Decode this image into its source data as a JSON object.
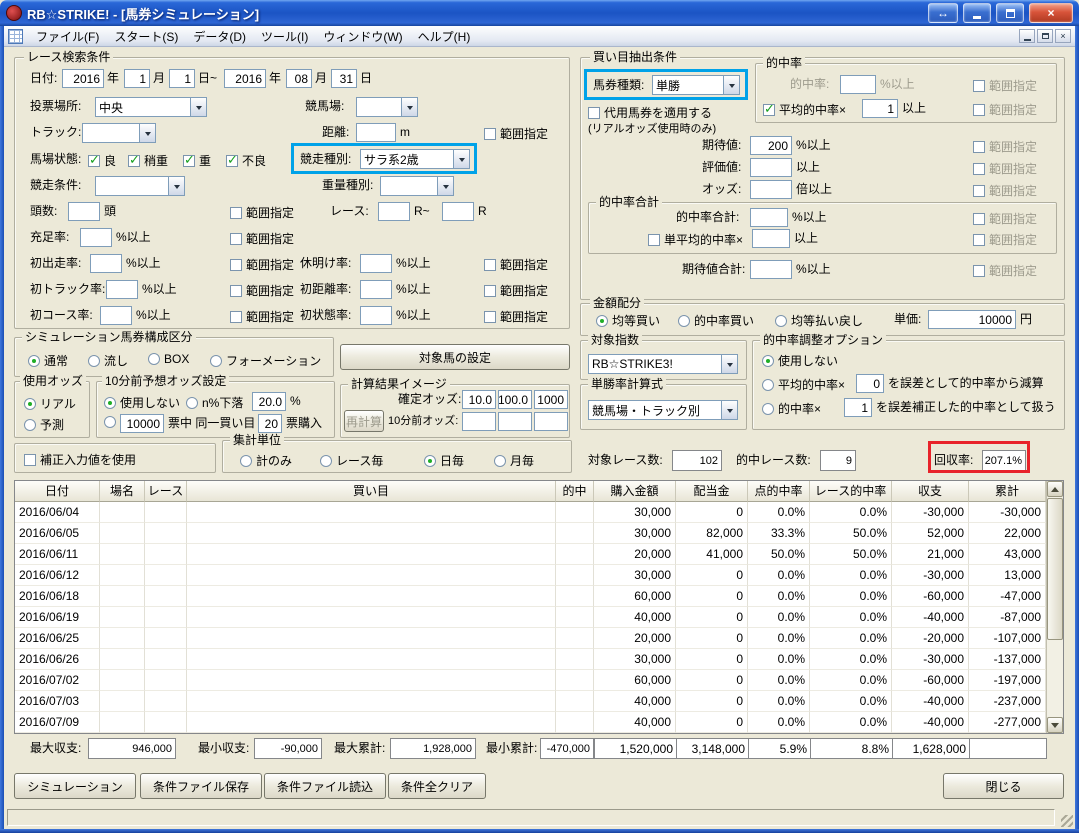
{
  "window": {
    "title": "RB☆STRIKE! - [馬券シミュレーション]"
  },
  "menu": {
    "items": [
      "ファイル(F)",
      "スタート(S)",
      "データ(D)",
      "ツール(I)",
      "ウィンドウ(W)",
      "ヘルプ(H)"
    ]
  },
  "icons": {
    "swap": "↔",
    "close": "×",
    "mdi_close": "×"
  },
  "common": {
    "range": "範囲指定",
    "pct_min": "%以上",
    "min": "以上"
  },
  "race_search": {
    "title": "レース検索条件",
    "date": {
      "label": "日付:",
      "from_year": "2016",
      "y1": "年",
      "from_month": "1",
      "m1": "月",
      "from_day": "1",
      "d1": "日~",
      "to_year": "2016",
      "y2": "年",
      "to_month": "08",
      "m2": "月",
      "to_day": "31",
      "d2": "日"
    },
    "place": {
      "label": "投票場所:",
      "value": "中央"
    },
    "course": {
      "label": "競馬場:",
      "value": ""
    },
    "track": {
      "label": "トラック:",
      "value": ""
    },
    "distance": {
      "label": "距離:",
      "value": "",
      "unit": "m"
    },
    "baba_label": "馬場状態:",
    "cond_good": {
      "label": "良",
      "checked": true
    },
    "cond_yayaomo": {
      "label": "稍重",
      "checked": true
    },
    "cond_omo": {
      "label": "重",
      "checked": true
    },
    "cond_bad": {
      "label": "不良",
      "checked": true
    },
    "race_type": {
      "label": "競走種別:",
      "value": "サラ系2歳"
    },
    "race_cond": {
      "label": "競走条件:",
      "value": ""
    },
    "weight_type": {
      "label": "重量種別:",
      "value": ""
    },
    "heads": {
      "label": "頭数:",
      "value": "",
      "unit": "頭"
    },
    "race_no": {
      "label": "レース:",
      "from": "",
      "mid": "R~",
      "to": "",
      "unit": "R"
    },
    "fill_rate": {
      "label": "充足率:",
      "value": ""
    },
    "first_run": {
      "label": "初出走率:",
      "value": ""
    },
    "rest_rate": {
      "label": "休明け率:",
      "value": ""
    },
    "first_track": {
      "label": "初トラック率:",
      "value": ""
    },
    "first_dist": {
      "label": "初距離率:",
      "value": ""
    },
    "first_course": {
      "label": "初コース率:",
      "value": ""
    },
    "first_cond": {
      "label": "初状態率:",
      "value": ""
    }
  },
  "extraction": {
    "title": "買い目抽出条件",
    "ticket": {
      "label": "馬券種類:",
      "value": "単勝"
    },
    "hit_group": {
      "title": "的中率",
      "hit_rate": {
        "label": "的中率:",
        "value": ""
      },
      "avg_hit": {
        "label": "平均的中率×",
        "value": "1",
        "checked": true
      }
    },
    "substitute": {
      "label": "代用馬券を適用する",
      "checked": false,
      "note": "(リアルオッズ使用時のみ)"
    },
    "expectation": {
      "label": "期待値:",
      "value": "200"
    },
    "evaluation": {
      "label": "評価値:",
      "value": ""
    },
    "odds": {
      "label": "オッズ:",
      "value": "",
      "unit": "倍以上"
    },
    "total_group": {
      "title": "的中率合計",
      "hit_total": {
        "label": "的中率合計:",
        "value": ""
      },
      "single_avg": {
        "label": "単平均的中率×",
        "value": "",
        "checked": false
      }
    },
    "exp_total": {
      "label": "期待値合計:",
      "value": ""
    }
  },
  "amount": {
    "title": "金額配分",
    "equal": {
      "label": "均等買い",
      "checked": true
    },
    "hit_buy": {
      "label": "的中率買い",
      "checked": false
    },
    "equal_refund": {
      "label": "均等払い戻し",
      "checked": false
    },
    "unit_price": {
      "label": "単価:",
      "value": "10000",
      "unit": "円"
    }
  },
  "composition": {
    "title": "シミュレーション馬券構成区分",
    "normal": {
      "label": "通常",
      "checked": true
    },
    "nagashi": {
      "label": "流し",
      "checked": false
    },
    "box": {
      "label": "BOX",
      "checked": false
    },
    "formation": {
      "label": "フォーメーション",
      "checked": false
    }
  },
  "target_horse_button": "対象馬の設定",
  "odds_use": {
    "title": "使用オッズ",
    "real": {
      "label": "リアル",
      "checked": true
    },
    "predict": {
      "label": "予測",
      "checked": false
    }
  },
  "pre_odds": {
    "title": "10分前予想オッズ設定",
    "not_use": {
      "label": "使用しない",
      "checked": true
    },
    "drop": {
      "label": "n%下落",
      "value": "20.0",
      "unit": "%",
      "checked": false
    },
    "votes": {
      "checked": false,
      "value": "10000",
      "mid": "票中 同一買い目",
      "value2": "20",
      "unit": "票購入"
    }
  },
  "calc_image": {
    "title": "計算結果イメージ",
    "fixed_label": "確定オッズ:",
    "fixed": [
      "10.0",
      "100.0",
      "1000"
    ],
    "recalc": "再計算",
    "pre_label": "10分前オッズ:",
    "pre": [
      "",
      "",
      ""
    ]
  },
  "target_index": {
    "title": "対象指数",
    "value": "RB☆STRIKE3!"
  },
  "win_formula": {
    "title": "単勝率計算式",
    "value": "競馬場・トラック別"
  },
  "hit_adjust": {
    "title": "的中率調整オプション",
    "not_use": {
      "label": "使用しない",
      "checked": true
    },
    "avg": {
      "label": "平均的中率×",
      "value": "0",
      "suffix": "を誤差として的中率から減算",
      "checked": false
    },
    "hit": {
      "label": "的中率×",
      "value": "1",
      "suffix": "を誤差補正した的中率として扱う",
      "checked": false
    }
  },
  "correction": {
    "label": "補正入力値を使用",
    "checked": false
  },
  "agg": {
    "title": "集計単位",
    "total_only": {
      "label": "計のみ",
      "checked": false
    },
    "per_race": {
      "label": "レース毎",
      "checked": false
    },
    "per_day": {
      "label": "日毎",
      "checked": true
    },
    "per_month": {
      "label": "月毎",
      "checked": false
    }
  },
  "counts": {
    "target_label": "対象レース数:",
    "target": "102",
    "hit_label": "的中レース数:",
    "hit": "9",
    "recovery_label": "回収率:",
    "recovery": "207.1%"
  },
  "table": {
    "headers": [
      "日付",
      "場名",
      "レース",
      "買い目",
      "的中",
      "購入金額",
      "配当金",
      "点的中率",
      "レース的中率",
      "収支",
      "累計"
    ],
    "row_keys": [
      "date",
      "place",
      "race",
      "kaime",
      "hit",
      "purchase",
      "payout",
      "point_rate",
      "race_rate",
      "balance",
      "total"
    ],
    "rows": [
      {
        "date": "2016/06/04",
        "place": "",
        "race": "",
        "kaime": "",
        "hit": "",
        "purchase": "30,000",
        "payout": "0",
        "point_rate": "0.0%",
        "race_rate": "0.0%",
        "balance": "-30,000",
        "total": "-30,000"
      },
      {
        "date": "2016/06/05",
        "place": "",
        "race": "",
        "kaime": "",
        "hit": "",
        "purchase": "30,000",
        "payout": "82,000",
        "point_rate": "33.3%",
        "race_rate": "50.0%",
        "balance": "52,000",
        "total": "22,000"
      },
      {
        "date": "2016/06/11",
        "place": "",
        "race": "",
        "kaime": "",
        "hit": "",
        "purchase": "20,000",
        "payout": "41,000",
        "point_rate": "50.0%",
        "race_rate": "50.0%",
        "balance": "21,000",
        "total": "43,000"
      },
      {
        "date": "2016/06/12",
        "place": "",
        "race": "",
        "kaime": "",
        "hit": "",
        "purchase": "30,000",
        "payout": "0",
        "point_rate": "0.0%",
        "race_rate": "0.0%",
        "balance": "-30,000",
        "total": "13,000"
      },
      {
        "date": "2016/06/18",
        "place": "",
        "race": "",
        "kaime": "",
        "hit": "",
        "purchase": "60,000",
        "payout": "0",
        "point_rate": "0.0%",
        "race_rate": "0.0%",
        "balance": "-60,000",
        "total": "-47,000"
      },
      {
        "date": "2016/06/19",
        "place": "",
        "race": "",
        "kaime": "",
        "hit": "",
        "purchase": "40,000",
        "payout": "0",
        "point_rate": "0.0%",
        "race_rate": "0.0%",
        "balance": "-40,000",
        "total": "-87,000"
      },
      {
        "date": "2016/06/25",
        "place": "",
        "race": "",
        "kaime": "",
        "hit": "",
        "purchase": "20,000",
        "payout": "0",
        "point_rate": "0.0%",
        "race_rate": "0.0%",
        "balance": "-20,000",
        "total": "-107,000"
      },
      {
        "date": "2016/06/26",
        "place": "",
        "race": "",
        "kaime": "",
        "hit": "",
        "purchase": "30,000",
        "payout": "0",
        "point_rate": "0.0%",
        "race_rate": "0.0%",
        "balance": "-30,000",
        "total": "-137,000"
      },
      {
        "date": "2016/07/02",
        "place": "",
        "race": "",
        "kaime": "",
        "hit": "",
        "purchase": "60,000",
        "payout": "0",
        "point_rate": "0.0%",
        "race_rate": "0.0%",
        "balance": "-60,000",
        "total": "-197,000"
      },
      {
        "date": "2016/07/03",
        "place": "",
        "race": "",
        "kaime": "",
        "hit": "",
        "purchase": "40,000",
        "payout": "0",
        "point_rate": "0.0%",
        "race_rate": "0.0%",
        "balance": "-40,000",
        "total": "-237,000"
      },
      {
        "date": "2016/07/09",
        "place": "",
        "race": "",
        "kaime": "",
        "hit": "",
        "purchase": "40,000",
        "payout": "0",
        "point_rate": "0.0%",
        "race_rate": "0.0%",
        "balance": "-40,000",
        "total": "-277,000"
      }
    ]
  },
  "summary": {
    "max_balance_label": "最大収支:",
    "max_balance": "946,000",
    "min_balance_label": "最小収支:",
    "min_balance": "-90,000",
    "max_total_label": "最大累計:",
    "max_total": "1,928,000",
    "min_total_label": "最小累計:",
    "min_total": "-470,000",
    "purchase_total": "1,520,000",
    "payout_total": "3,148,000",
    "point_rate_total": "5.9%",
    "race_rate_total": "8.8%",
    "balance_total": "1,628,000",
    "total_total": ""
  },
  "buttons": {
    "simulate": "シミュレーション",
    "save": "条件ファイル保存",
    "load": "条件ファイル読込",
    "clear": "条件全クリア",
    "close": "閉じる"
  },
  "colors": {
    "highlight_blue": "#00a2e8",
    "highlight_red": "#e8232a",
    "title_blue": "#2a63c9"
  }
}
